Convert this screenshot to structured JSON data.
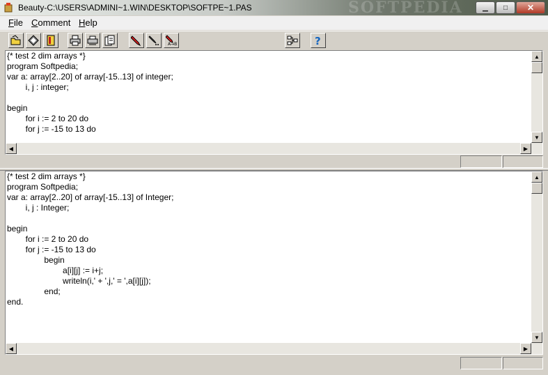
{
  "window": {
    "title": "Beauty-C:\\USERS\\ADMINI~1.WIN\\DESKTOP\\SOFTPE~1.PAS",
    "watermark": "SOFTPEDIA",
    "minimize_icon": "minimize-icon",
    "maximize_icon": "maximize-icon",
    "close_icon": "close-icon"
  },
  "menu": {
    "file": "File",
    "comment": "Comment",
    "help": "Help"
  },
  "toolbar": {
    "icons": [
      "open-folder-icon",
      "diamond-icon",
      "book-icon",
      "print-icon",
      "print-preview-icon",
      "copy-page-icon",
      "pen-icon",
      "pen-dots-icon",
      "pen-ab-icon",
      "tree-icon",
      "help-icon"
    ]
  },
  "source_pane": {
    "lines": [
      "{* test 2 dim arrays *}",
      "program Softpedia;",
      "var a: array[2..20] of array[-15..13] of integer;",
      "\t\ti, j : integer;",
      "",
      "begin",
      "\t\tfor i := 2 to 20 do",
      "\t\tfor j := -15 to 13 do"
    ]
  },
  "result_pane": {
    "lines": [
      "{* test 2 dim arrays *}",
      "program Softpedia;",
      "var a: array[2..20] of array[-15..13] of Integer;",
      "\t\ti, j : Integer;",
      "",
      "begin",
      "\t\tfor i := 2 to 20 do",
      "\t\tfor j := -15 to 13 do",
      "\t\t\t\tbegin",
      "\t\t\t\t\t\ta[i][j] := i+j;",
      "\t\t\t\t\t\twriteln(i,' + ',j,' = ',a[i][j]);",
      "\t\t\t\tend;",
      "end."
    ]
  },
  "colors": {
    "chrome": "#d4d0c8",
    "editor_bg": "#ffffff",
    "help_blue": "#1565c0"
  }
}
